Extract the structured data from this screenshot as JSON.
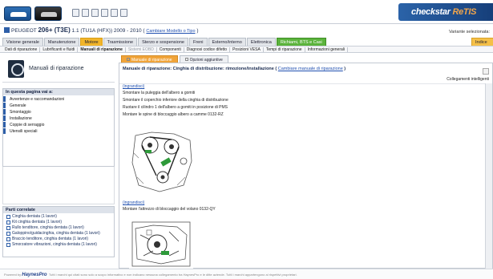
{
  "header": {
    "icons": [
      "car-logo-icon",
      "vehicle-logo-icon",
      "toolbar-icons"
    ],
    "brand_name_a": "check",
    "brand_name_b": "star",
    "brand_name_c": "ReTIS",
    "accent": "#2b63a8"
  },
  "vehicle": {
    "make": "PEUGEOT",
    "model": "206+ (T3E)",
    "engine": "1.1 (TU1A (HFX)) 2009 - 2010",
    "change_link": "Cambiare Modello o Tipo",
    "variant_label": "Variante selezionata:"
  },
  "tabs_primary": [
    {
      "label": "Visione generale"
    },
    {
      "label": "Manutenzione"
    },
    {
      "label": "Motore"
    },
    {
      "label": "Trasmissione"
    },
    {
      "label": "Sterzo e sospensione"
    },
    {
      "label": "Freni"
    },
    {
      "label": "Esterno/interno"
    },
    {
      "label": "Elettronica"
    },
    {
      "label": "Richiami, BTS e Casi"
    },
    {
      "label": "Indice"
    }
  ],
  "tabs_secondary": [
    {
      "label": "Dati di riparazione"
    },
    {
      "label": "Lubrificanti e fluidi"
    },
    {
      "label": "Manuali di riparazione"
    },
    {
      "label": "Sistemi EOBD"
    },
    {
      "label": "Componenti"
    },
    {
      "label": "Diagnosi codice difetto"
    },
    {
      "label": "Posizioni VESA"
    },
    {
      "label": "Tempi di riparazione"
    },
    {
      "label": "Informazioni generali"
    }
  ],
  "left": {
    "manual_title": "Manuali di riparazione",
    "in_page_title": "In questa pagina vai a:",
    "in_page_items": [
      "Avvertenze e raccomandazioni",
      "Generale",
      "Smontaggio",
      "Installazione",
      "Coppie di serraggio",
      "Utensili speciali"
    ],
    "related_title": "Parti correlate",
    "related_items": [
      "Cinghia dentata (1 lavori)",
      "Kit cinghia dentata (1 lavori)",
      "Rullo tenditore, cinghia dentata (1 lavori)",
      "Galoppino/guidacinghia, cinghia dentata (1 lavori)",
      "Braccio tenditore, cinghia dentata (1 lavori)",
      "Smorzatore vibrazioni, cinghia dentata (1 lavori)"
    ]
  },
  "main": {
    "tab_manual": "Manuale di riparazione",
    "tab_options": "Opzioni aggiuntive",
    "title": "Manuale di riparazione: Cinghia di distribuzione: rimozione/installazione",
    "change_link": "Cambiare manuale di riparazione",
    "links_label": "Collegamenti intelligenti",
    "top_link": "(ingrandisci)",
    "steps": [
      "Smontare la puleggia dell'albero a gomiti",
      "Smontare il coperchio inferiore della cinghia di distribuzione",
      "Ruotare il cilindro 1 dell'albero a gomiti in posizione di PMS",
      "Montare le spine di bloccaggio albero a camme 0132-RZ"
    ],
    "enlarge_link": "(ingrandisci)",
    "step_after": "Montare l'attrezzo di bloccaggio del volano 0132-QY"
  },
  "footer": {
    "powered": "Powered by",
    "brand": "HaynesPro",
    "disclaimer": "Tutti i marchi qui citati sono solo a scopo informativo e non indicano nessuna collegamento tra HaynesPro e le ditte aziende. Tutti i marchi appartengono ai rispettivi proprietari."
  }
}
